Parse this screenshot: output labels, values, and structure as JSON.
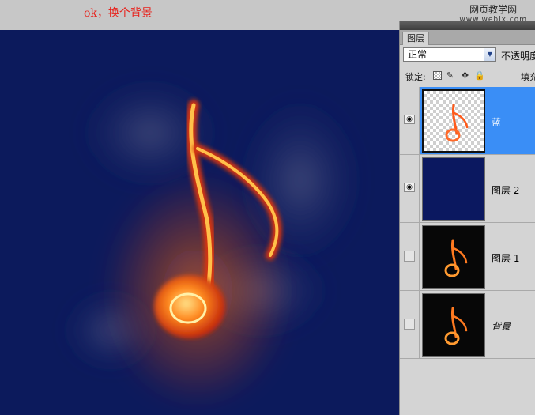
{
  "caption": "ok，换个背景",
  "watermark": {
    "site": "网页教学网",
    "url": "www.webjx.com"
  },
  "canvas": {
    "background": "#0c1a5c"
  },
  "layers_panel": {
    "tab_label": "图层",
    "blend_mode": "正常",
    "opacity_label": "不透明度",
    "lock_label": "锁定:",
    "fill_label": "填充",
    "layers": [
      {
        "name": "蓝",
        "visible": true,
        "selected": true,
        "thumbnail": "fire-note-transparent"
      },
      {
        "name": "图层 2",
        "visible": true,
        "selected": false,
        "thumbnail": "navy-fill"
      },
      {
        "name": "图层 1",
        "visible": false,
        "selected": false,
        "thumbnail": "fire-note-black"
      },
      {
        "name": "背景",
        "visible": false,
        "selected": false,
        "thumbnail": "fire-note-black"
      }
    ],
    "colors": {
      "selected": "#3a8ef6",
      "panel": "#d4d4d4"
    }
  }
}
